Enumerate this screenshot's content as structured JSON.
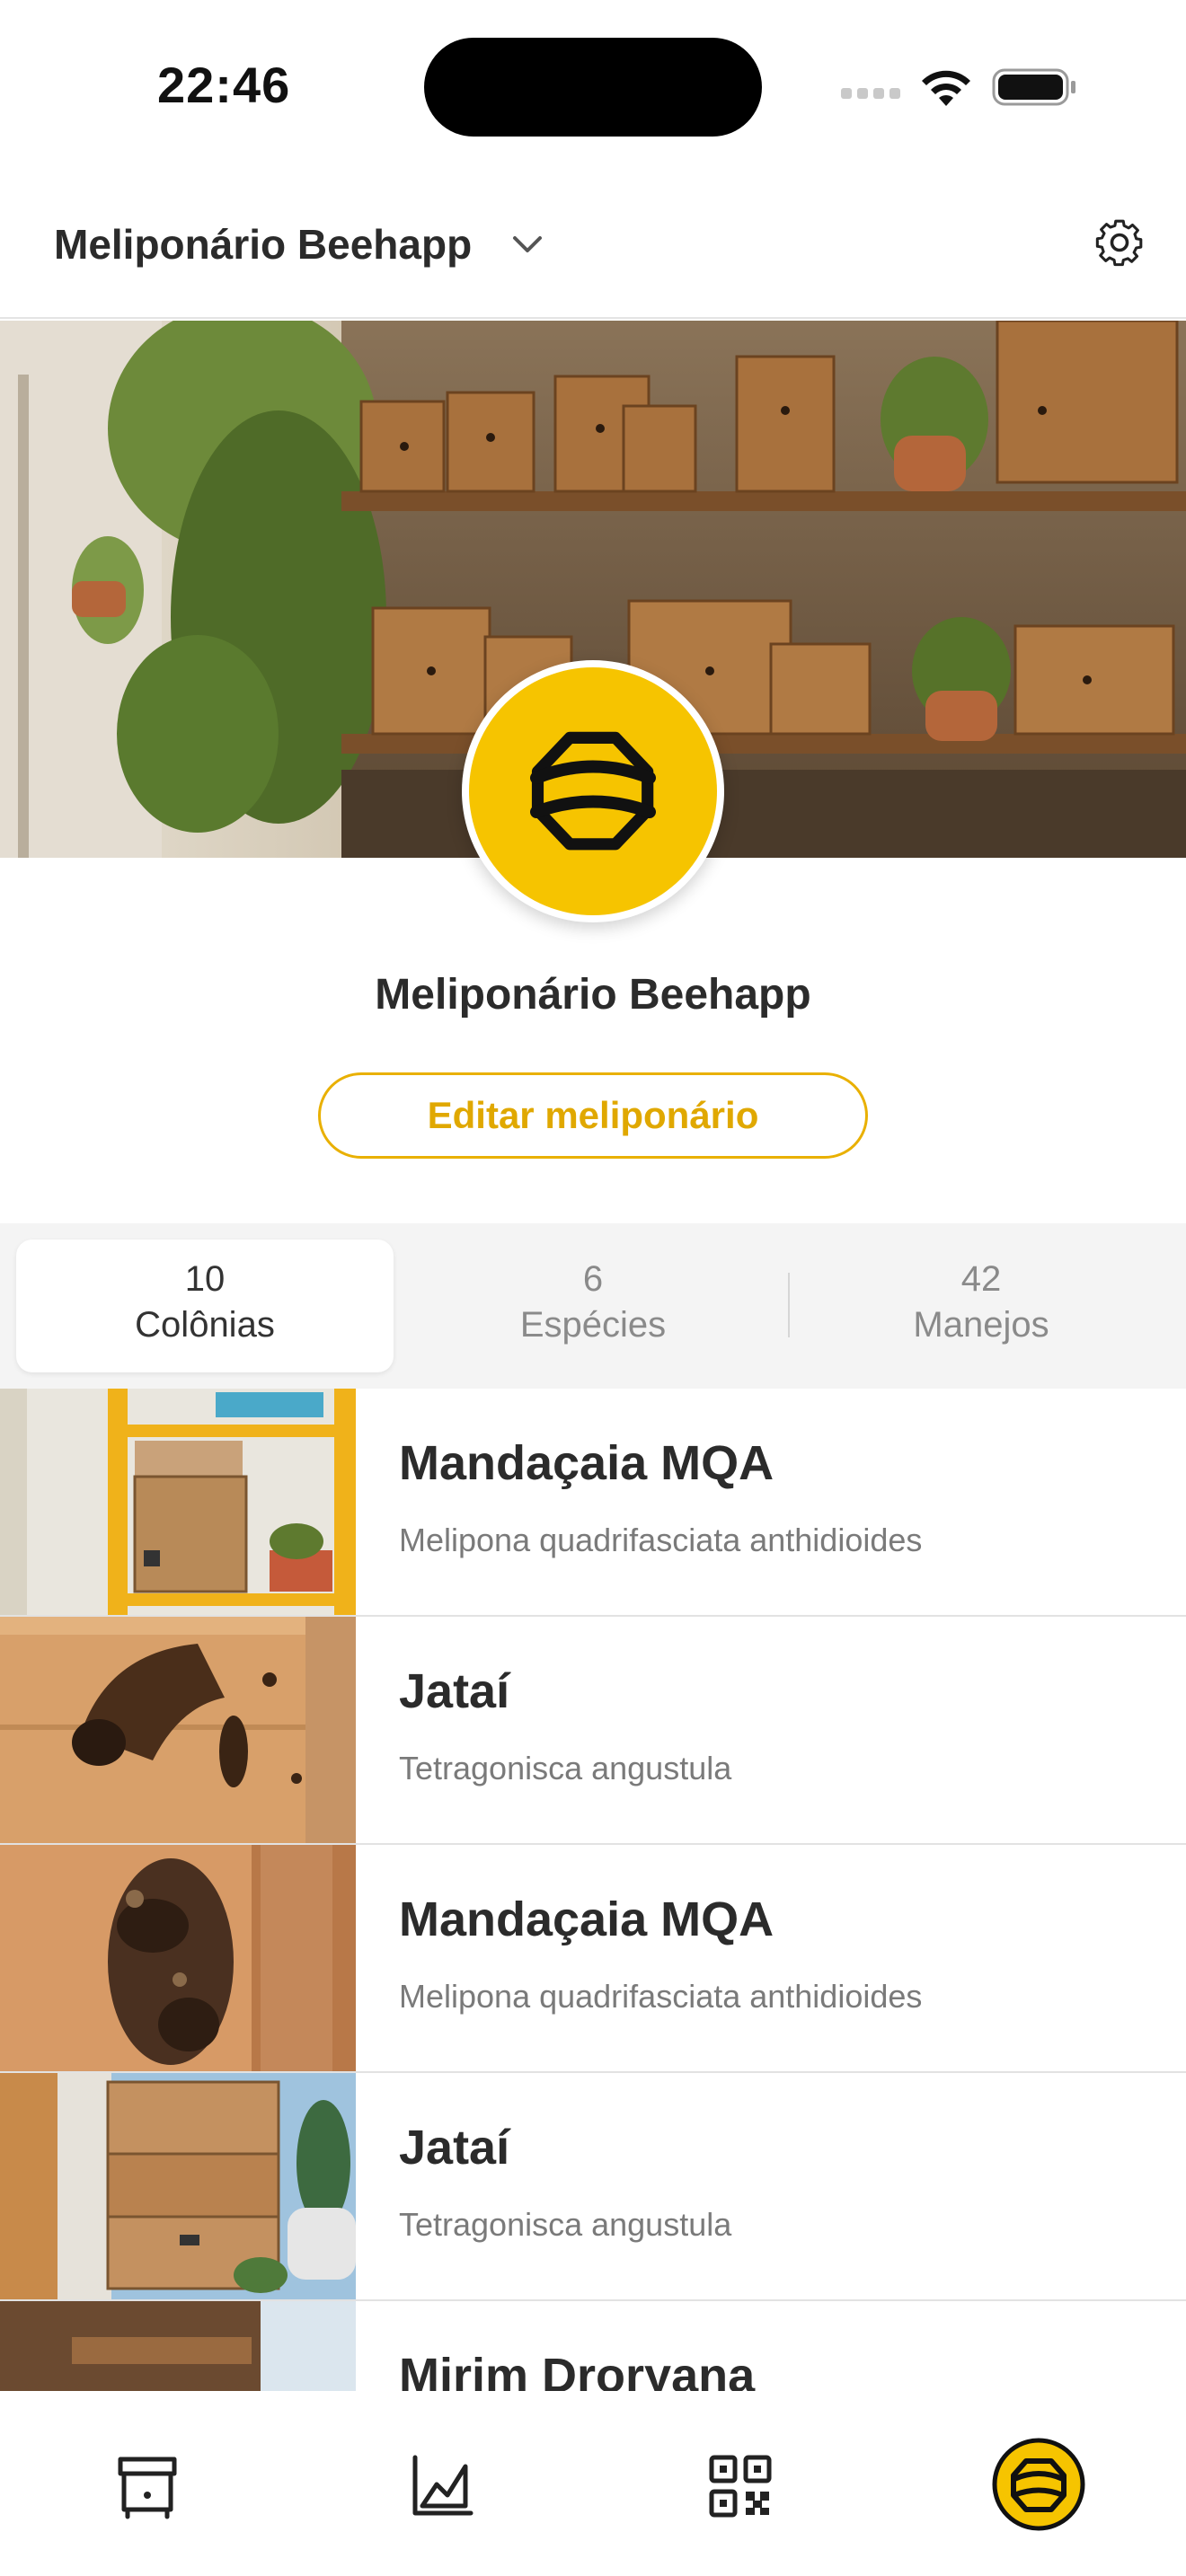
{
  "status": {
    "time": "22:46"
  },
  "header": {
    "title": "Meliponário Beehapp"
  },
  "profile": {
    "name": "Meliponário Beehapp",
    "edit_label": "Editar meliponário"
  },
  "stats": [
    {
      "count": "10",
      "label": "Colônias",
      "active": true
    },
    {
      "count": "6",
      "label": "Espécies",
      "active": false
    },
    {
      "count": "42",
      "label": "Manejos",
      "active": false
    }
  ],
  "colonies": [
    {
      "name": "Mandaçaia MQA",
      "species": "Melipona quadrifasciata anthidioides"
    },
    {
      "name": "Jataí",
      "species": "Tetragonisca angustula"
    },
    {
      "name": "Mandaçaia MQA",
      "species": "Melipona quadrifasciata anthidioides"
    },
    {
      "name": "Jataí",
      "species": "Tetragonisca angustula"
    },
    {
      "name": "Mirim Droryana",
      "species": ""
    }
  ],
  "tabs": [
    {
      "icon": "hive-box-icon"
    },
    {
      "icon": "chart-icon"
    },
    {
      "icon": "qr-code-icon"
    },
    {
      "icon": "beehapp-logo-icon"
    }
  ],
  "colors": {
    "accent": "#f6c400",
    "accent_text": "#e0a800",
    "text": "#2b2b2b",
    "muted": "#7a7a7a"
  }
}
